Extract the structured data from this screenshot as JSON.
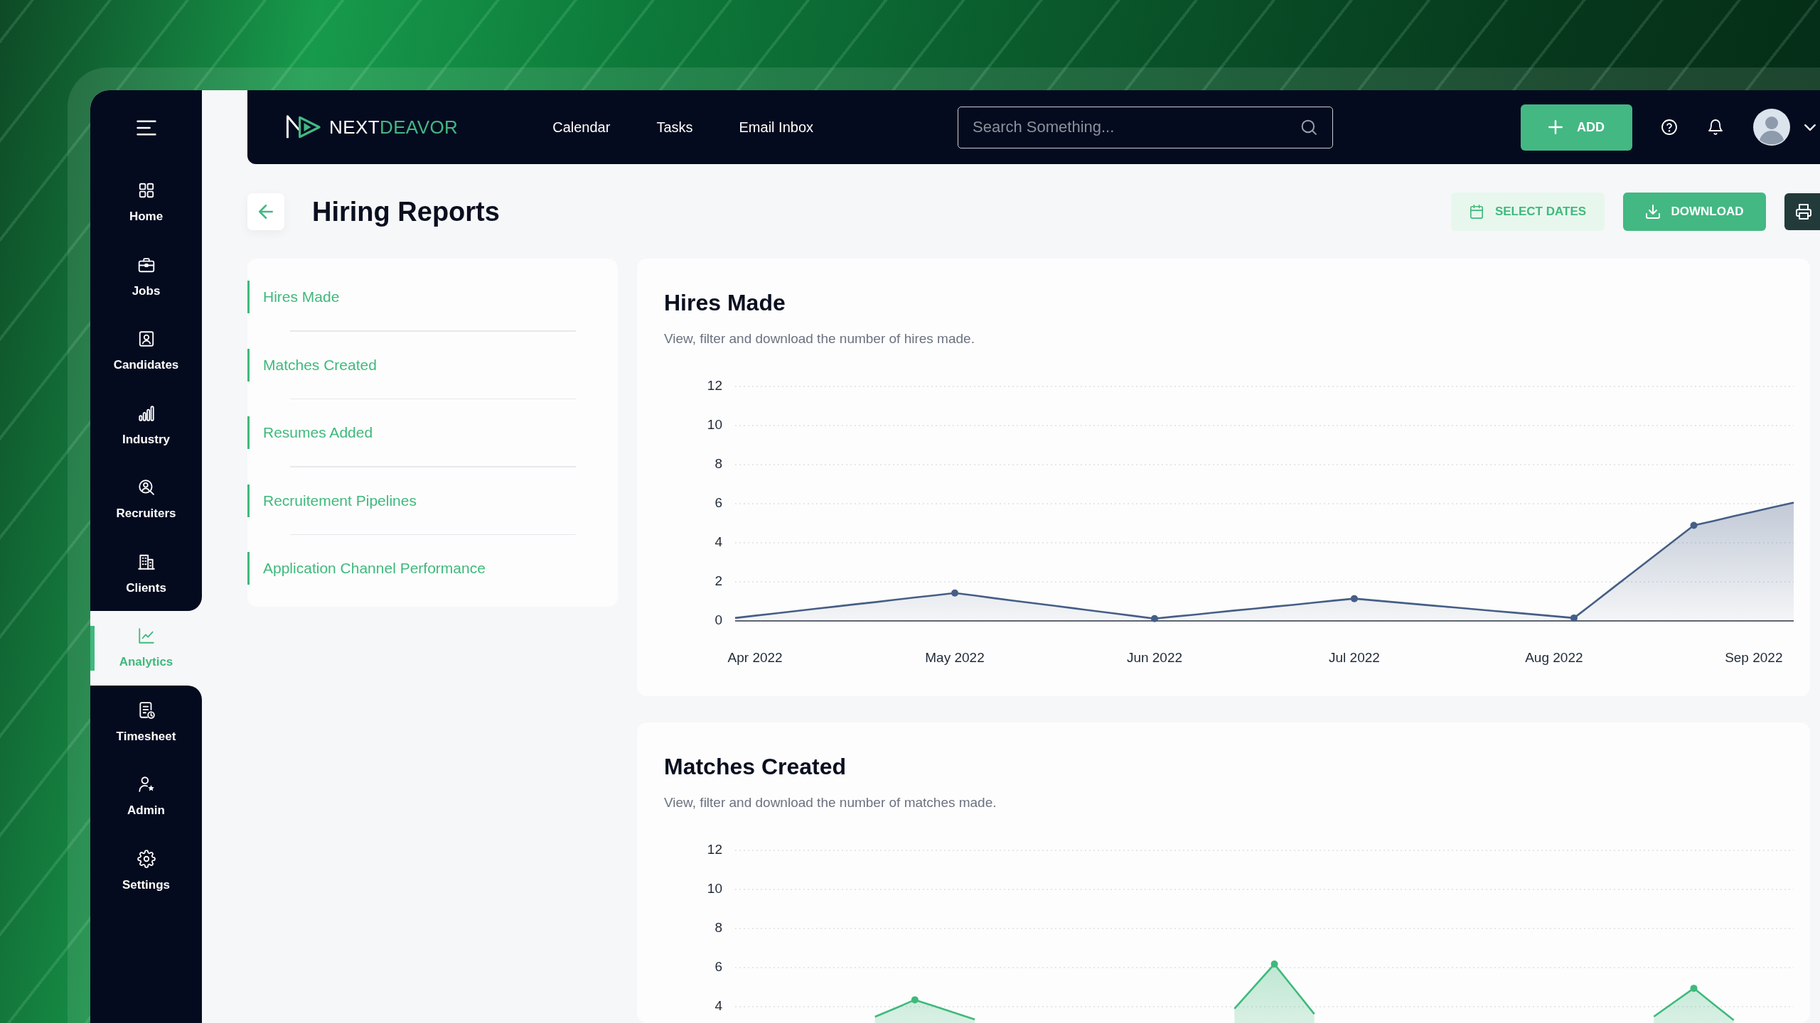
{
  "nav": {
    "logo_text": [
      "NEXT",
      "DEAVOR"
    ],
    "links": [
      "Calendar",
      "Tasks",
      "Email Inbox"
    ],
    "search": {
      "placeholder": "Search Something..."
    },
    "add_button": "ADD"
  },
  "sidebar": {
    "items": [
      {
        "label": "Home",
        "selected": false
      },
      {
        "label": "Jobs",
        "selected": false
      },
      {
        "label": "Candidates",
        "selected": false
      },
      {
        "label": "Industry",
        "selected": false
      },
      {
        "label": "Recruiters",
        "selected": false
      },
      {
        "label": "Clients",
        "selected": false
      },
      {
        "label": "Analytics",
        "selected": true
      },
      {
        "label": "Timesheet",
        "selected": false
      },
      {
        "label": "Admin",
        "selected": false
      },
      {
        "label": "Settings",
        "selected": false
      }
    ]
  },
  "page": {
    "title": "Hiring Reports",
    "select_dates_button": "SELECT DATES",
    "download_button": "DOWNLOAD"
  },
  "report_menu": [
    "Hires Made",
    "Matches Created",
    "Resumes Added",
    "Recruitement Pipelines",
    "Application Channel Performance"
  ],
  "reports": [
    {
      "title": "Hires Made",
      "subtitle": "View, filter and download the number of hires made.",
      "chart_data": {
        "type": "area",
        "grid": true,
        "categories": [
          null,
          "Apr 2022",
          null,
          null,
          null,
          null,
          null,
          null,
          null,
          null,
          null,
          "May 2022",
          null,
          null,
          null,
          null,
          null,
          null,
          null,
          null,
          null,
          "Jun 2022",
          null,
          null,
          null,
          null,
          null,
          null,
          null,
          null,
          null,
          "Jul 2022",
          null,
          null,
          null,
          null,
          null,
          null,
          null,
          null,
          null,
          "Aug 2022",
          null,
          null,
          null,
          null,
          null,
          null,
          null,
          null,
          null,
          "Sep 2022",
          null,
          null
        ],
        "series": [
          {
            "color": "#455e85",
            "values": [
              0.15,
              0.27,
              0.38,
              0.5,
              0.62,
              0.73,
              0.85,
              0.96,
              1.08,
              1.2,
              1.31,
              1.43,
              1.3,
              1.16,
              1.03,
              0.9,
              0.77,
              0.64,
              0.51,
              0.38,
              0.25,
              0.12,
              0.22,
              0.32,
              0.43,
              0.53,
              0.63,
              0.73,
              0.83,
              0.94,
              1.04,
              1.14,
              1.05,
              0.96,
              0.87,
              0.78,
              0.69,
              0.6,
              0.51,
              0.42,
              0.33,
              0.24,
              0.15,
              0.94,
              1.73,
              2.52,
              3.31,
              4.1,
              4.89,
              5.12,
              5.36,
              5.59,
              5.83,
              6.06
            ]
          }
        ],
        "ylim": [
          0,
          12
        ],
        "yticks": [
          0,
          2,
          4,
          6,
          8,
          10,
          12
        ]
      }
    },
    {
      "title": "Matches Created",
      "subtitle": "View, filter and download the number of matches made.",
      "chart_data": {
        "type": "area",
        "grid": true,
        "series": [
          {
            "color": "#3fb97c",
            "values": [
              null,
              null,
              null,
              null,
              null,
              null,
              null,
              3.48,
              3.91,
              4.35,
              4.02,
              3.68,
              3.35,
              null,
              null,
              null,
              null,
              null,
              null,
              null,
              null,
              null,
              null,
              null,
              null,
              3.9,
              5.04,
              6.18,
              4.9,
              3.62,
              null,
              null,
              null,
              null,
              null,
              null,
              null,
              null,
              null,
              null,
              null,
              null,
              null,
              null,
              null,
              null,
              3.49,
              4.22,
              4.94,
              4.12,
              3.31,
              null,
              null,
              null
            ]
          }
        ],
        "ylim": [
          0,
          12
        ],
        "yticks": [
          4,
          6,
          8,
          10,
          12
        ]
      }
    }
  ]
}
